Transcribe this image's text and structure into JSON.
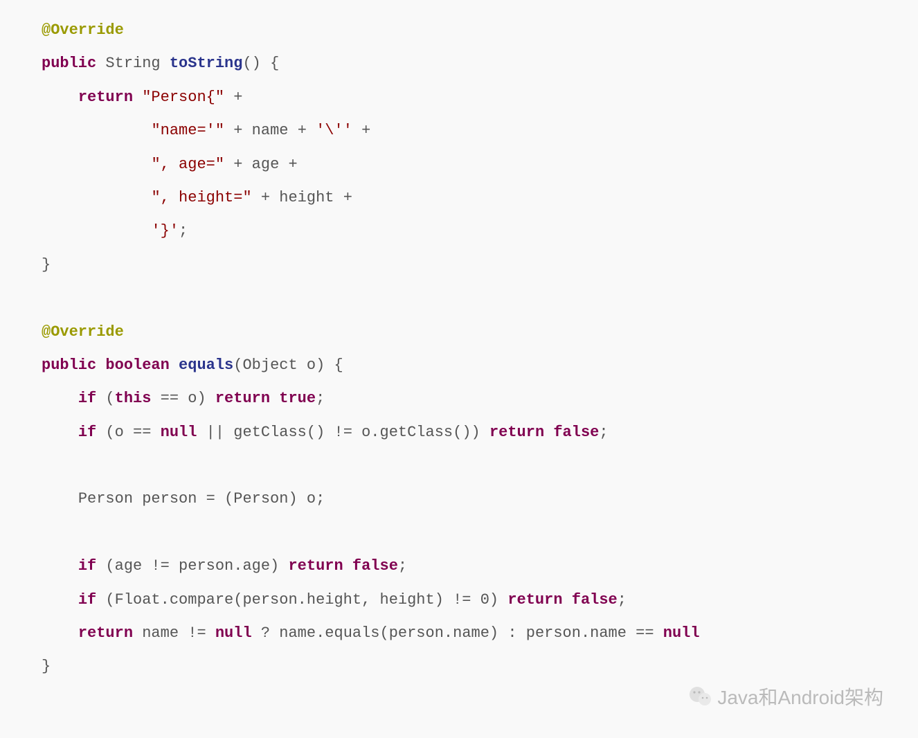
{
  "code": {
    "annotation1": "@Override",
    "kw_public1": "public",
    "type_string": "String",
    "method_toString": "toString",
    "parens1": "()",
    "brace_open1": "{",
    "kw_return1": "return",
    "str_person_open": "\"Person{\"",
    "op_plus": "+",
    "str_name_eq": "\"name='\"",
    "var_name": "name",
    "char_esc_quote": "'\\''",
    "str_age_eq": "\", age=\"",
    "var_age": "age",
    "str_height_eq": "\", height=\"",
    "var_height": "height",
    "char_close_brace": "'}'",
    "semicolon": ";",
    "brace_close1": "}",
    "annotation2": "@Override",
    "kw_public2": "public",
    "kw_boolean": "boolean",
    "method_equals": "equals",
    "param_object": "(Object o)",
    "brace_open2": "{",
    "kw_if1": "if",
    "cond1_open": "(",
    "kw_this": "this",
    "op_eqeq1": " == ",
    "var_o1": "o",
    "cond1_close": ")",
    "kw_return2": "return",
    "kw_true1": "true",
    "kw_if2": "if",
    "cond2": "(o == ",
    "kw_null1": "null",
    "cond2b": " || getClass() != o.getClass())",
    "kw_return3": "return",
    "kw_false1": "false",
    "cast_line": "Person person = (Person) o;",
    "kw_if3": "if",
    "cond3": "(age != person.age)",
    "kw_return4": "return",
    "kw_false2": "false",
    "kw_if4": "if",
    "cond4": "(Float.compare(person.height, height) != 0)",
    "kw_return5": "return",
    "kw_false3": "false",
    "kw_return6": "return",
    "final_expr_a": "name != ",
    "kw_null2": "null",
    "final_expr_b": " ? name.equals(person.name) : person.name == ",
    "kw_null3": "null",
    "brace_close2": "}"
  },
  "watermark": {
    "text": "Java和Android架构"
  }
}
